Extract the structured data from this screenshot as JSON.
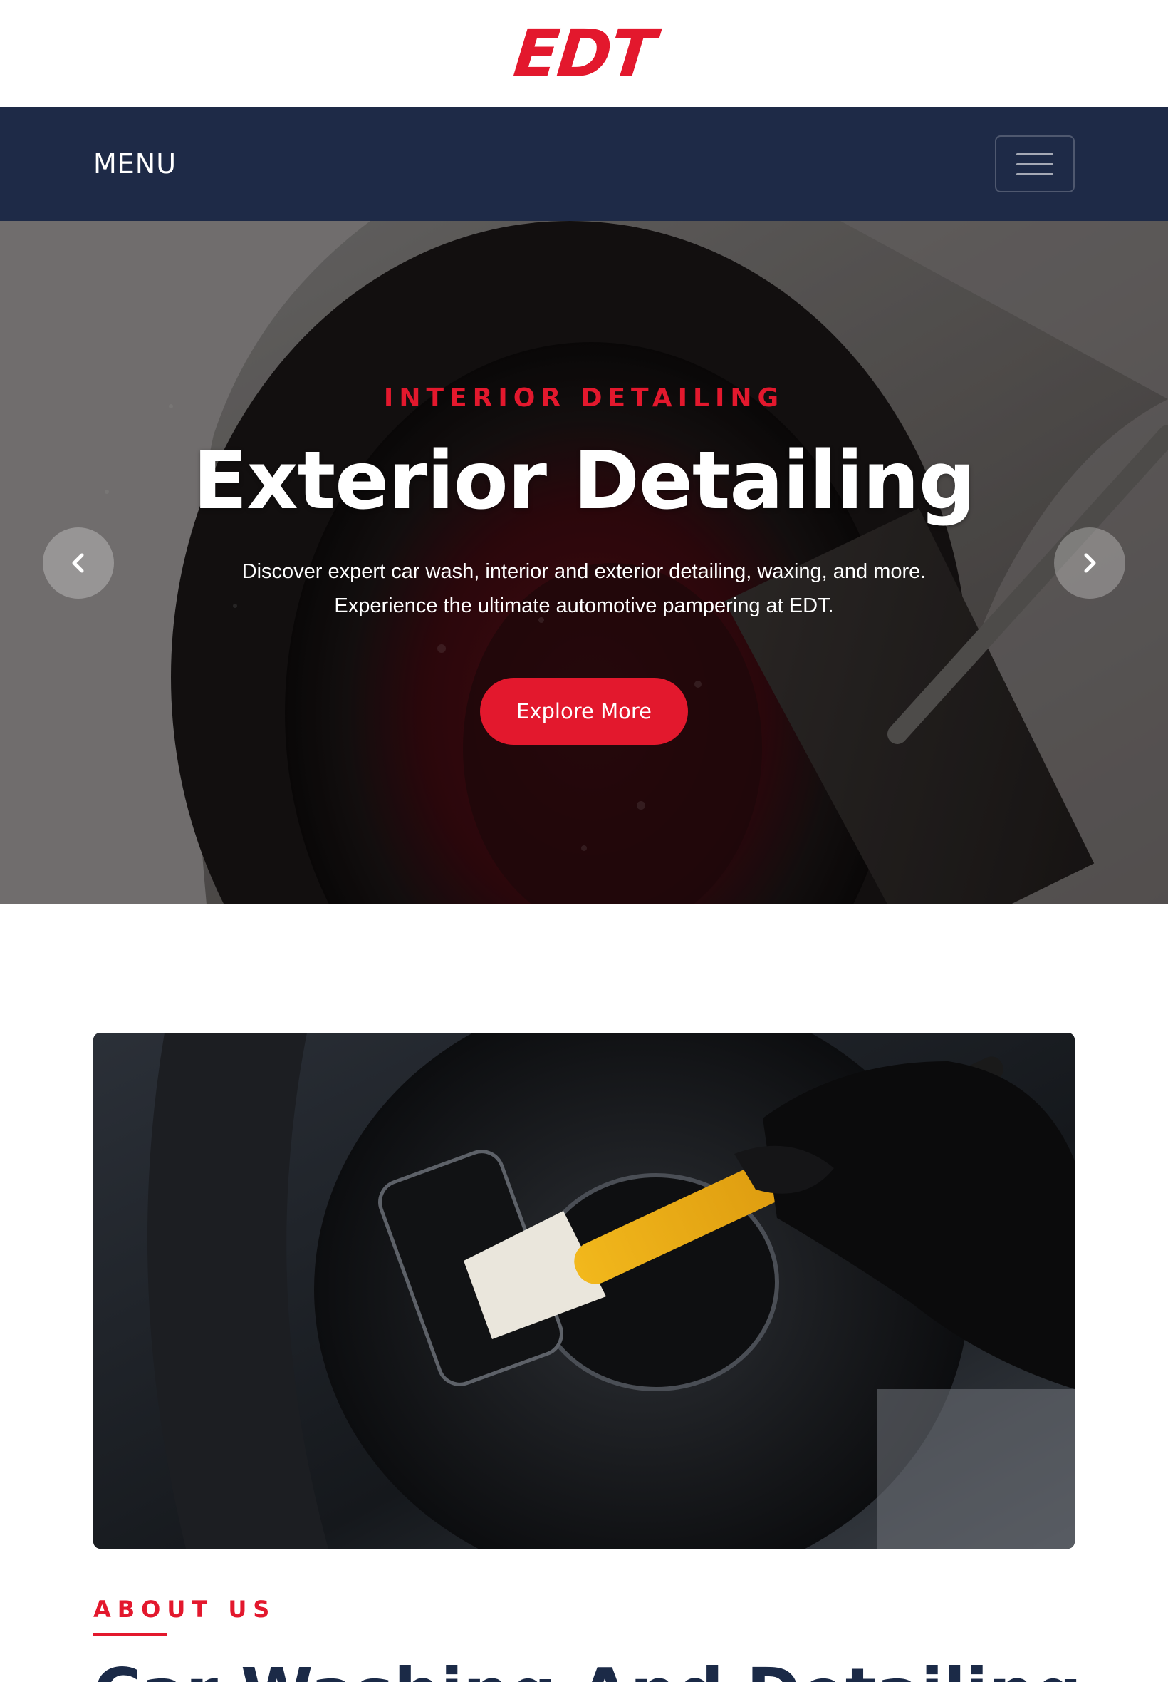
{
  "brand": {
    "logo_text": "EDT"
  },
  "nav": {
    "menu_label": "MENU",
    "toggler_icon": "hamburger-icon"
  },
  "hero": {
    "eyebrow": "INTERIOR DETAILING",
    "title": "Exterior Detailing",
    "description": "Discover expert car wash, interior and exterior detailing, waxing, and more. Experience the ultimate automotive pampering at EDT.",
    "cta_label": "Explore More",
    "prev_icon": "chevron-left-icon",
    "next_icon": "chevron-right-icon"
  },
  "about": {
    "eyebrow": "ABOUT US",
    "heading": "Car Washing And Detailing"
  },
  "colors": {
    "accent": "#e3182d",
    "navbar": "#1e2a47",
    "heading": "#1b2a47"
  }
}
